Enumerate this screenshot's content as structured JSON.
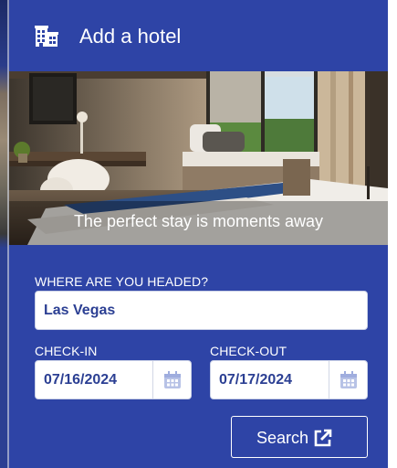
{
  "header": {
    "title": "Add a hotel",
    "icon": "hotel-building-icon"
  },
  "hero": {
    "caption": "The perfect stay is moments away"
  },
  "destination": {
    "label": "WHERE ARE YOU HEADED?",
    "value": "Las Vegas"
  },
  "checkin": {
    "label": "CHECK-IN",
    "value": "07/16/2024",
    "icon": "calendar-icon"
  },
  "checkout": {
    "label": "CHECK-OUT",
    "value": "07/17/2024",
    "icon": "calendar-icon"
  },
  "search": {
    "label": "Search",
    "icon": "external-link-icon"
  },
  "colors": {
    "panel": "#2e44a6",
    "value_text": "#2b3f93",
    "field_bg": "#ffffff"
  }
}
